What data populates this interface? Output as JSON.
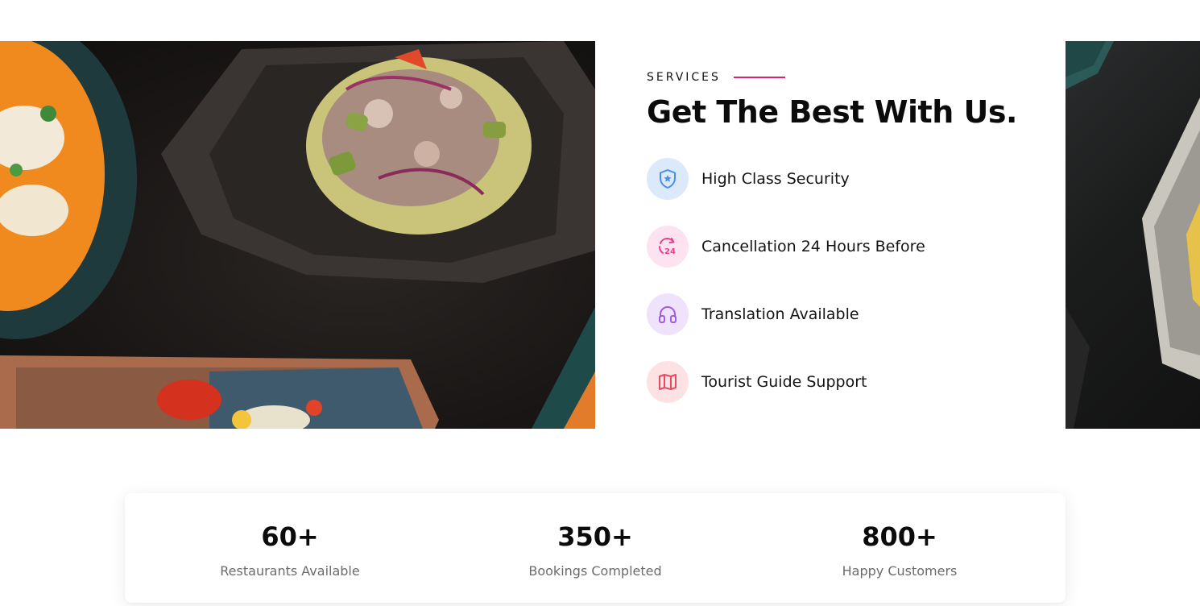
{
  "services": {
    "eyebrow": "SERVICES",
    "title": "Get The Best With Us.",
    "accent_color": "#d6246e",
    "items": [
      {
        "label": "High Class Security",
        "icon": "shield-star-icon",
        "icon_color": "#4a90e2",
        "bg_color": "#dbe9fb"
      },
      {
        "label": "Cancellation 24 Hours Before",
        "icon": "refresh-24-icon",
        "icon_color": "#e8408a",
        "bg_color": "#fce3ef"
      },
      {
        "label": "Translation Available",
        "icon": "headphones-icon",
        "icon_color": "#a35be0",
        "bg_color": "#efe3fb"
      },
      {
        "label": "Tourist Guide Support",
        "icon": "map-icon",
        "icon_color": "#e84a5f",
        "bg_color": "#fde2e4"
      }
    ]
  },
  "stats": [
    {
      "value": "60+",
      "label": "Restaurants Available"
    },
    {
      "value": "350+",
      "label": "Bookings Completed"
    },
    {
      "value": "800+",
      "label": "Happy Customers"
    }
  ]
}
